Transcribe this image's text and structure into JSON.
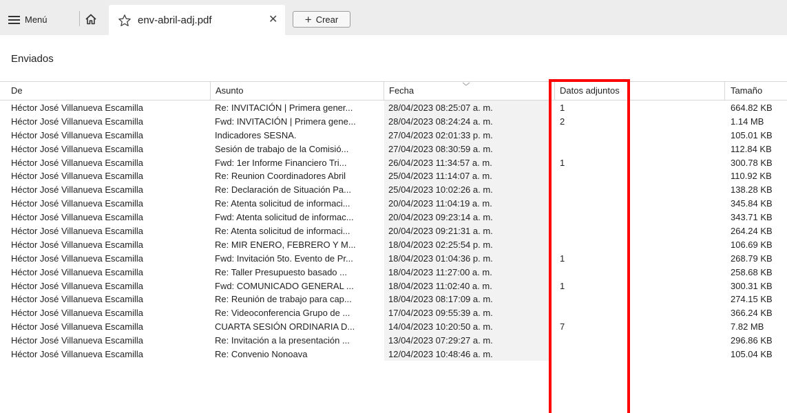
{
  "toolbar": {
    "menu_label": "Menú",
    "home_icon": "home-icon",
    "create_label": "Crear",
    "create_icon": "plus-icon"
  },
  "tab": {
    "title": "env-abril-adj.pdf",
    "star_icon": "star-outline-icon",
    "close_glyph": "✕"
  },
  "folder": {
    "title": "Enviados"
  },
  "table": {
    "columns": {
      "from": "De",
      "subject": "Asunto",
      "date": "Fecha",
      "attachments": "Datos adjuntos",
      "size": "Tamaño"
    },
    "sorted_column": "date",
    "rows": [
      {
        "from": "Héctor José Villanueva Escamilla",
        "subject": "Re: INVITACIÓN | Primera gener...",
        "date": "28/04/2023 08:25:07 a. m.",
        "attachments": "1",
        "size": "664.82 KB"
      },
      {
        "from": "Héctor José Villanueva Escamilla",
        "subject": "Fwd: INVITACIÓN | Primera gene...",
        "date": "28/04/2023 08:24:24 a. m.",
        "attachments": "2",
        "size": "1.14 MB"
      },
      {
        "from": "Héctor José Villanueva Escamilla",
        "subject": "Indicadores SESNA.",
        "date": "27/04/2023 02:01:33 p. m.",
        "attachments": "",
        "size": "105.01 KB"
      },
      {
        "from": "Héctor José Villanueva Escamilla",
        "subject": "Sesión de trabajo de la Comisió...",
        "date": "27/04/2023 08:30:59 a. m.",
        "attachments": "",
        "size": "112.84 KB"
      },
      {
        "from": "Héctor José Villanueva Escamilla",
        "subject": "Fwd: 1er Informe Financiero Tri...",
        "date": "26/04/2023 11:34:57 a. m.",
        "attachments": "1",
        "size": "300.78 KB"
      },
      {
        "from": "Héctor José Villanueva Escamilla",
        "subject": "Re: Reunion Coordinadores Abril",
        "date": "25/04/2023 11:14:07 a. m.",
        "attachments": "",
        "size": "110.92 KB"
      },
      {
        "from": "Héctor José Villanueva Escamilla",
        "subject": "Re: Declaración de Situación Pa...",
        "date": "25/04/2023 10:02:26 a. m.",
        "attachments": "",
        "size": "138.28 KB"
      },
      {
        "from": "Héctor José Villanueva Escamilla",
        "subject": "Re: Atenta solicitud de informaci...",
        "date": "20/04/2023 11:04:19 a. m.",
        "attachments": "",
        "size": "345.84 KB"
      },
      {
        "from": "Héctor José Villanueva Escamilla",
        "subject": "Fwd: Atenta solicitud de informac...",
        "date": "20/04/2023 09:23:14 a. m.",
        "attachments": "",
        "size": "343.71 KB"
      },
      {
        "from": "Héctor José Villanueva Escamilla",
        "subject": "Re: Atenta solicitud de informaci...",
        "date": "20/04/2023 09:21:31 a. m.",
        "attachments": "",
        "size": "264.24 KB"
      },
      {
        "from": "Héctor José Villanueva Escamilla",
        "subject": "Re: MIR ENERO, FEBRERO Y M...",
        "date": "18/04/2023 02:25:54 p. m.",
        "attachments": "",
        "size": "106.69 KB"
      },
      {
        "from": "Héctor José Villanueva Escamilla",
        "subject": "Fwd: Invitación 5to. Evento de Pr...",
        "date": "18/04/2023 01:04:36 p. m.",
        "attachments": "1",
        "size": "268.79 KB"
      },
      {
        "from": "Héctor José Villanueva Escamilla",
        "subject": "Re: Taller Presupuesto basado ...",
        "date": "18/04/2023 11:27:00 a. m.",
        "attachments": "",
        "size": "258.68 KB"
      },
      {
        "from": "Héctor José Villanueva Escamilla",
        "subject": "Fwd: COMUNICADO GENERAL ...",
        "date": "18/04/2023 11:02:40 a. m.",
        "attachments": "1",
        "size": "300.31 KB"
      },
      {
        "from": "Héctor José Villanueva Escamilla",
        "subject": "Re: Reunión de trabajo para cap...",
        "date": "18/04/2023 08:17:09 a. m.",
        "attachments": "",
        "size": "274.15 KB"
      },
      {
        "from": "Héctor José Villanueva Escamilla",
        "subject": "Re: Videoconferencia Grupo de ...",
        "date": "17/04/2023 09:55:39 a. m.",
        "attachments": "",
        "size": "366.24 KB"
      },
      {
        "from": "Héctor José Villanueva Escamilla",
        "subject": "CUARTA SESIÓN ORDINARIA D...",
        "date": "14/04/2023 10:20:50 a. m.",
        "attachments": "7",
        "size": "7.82 MB"
      },
      {
        "from": "Héctor José Villanueva Escamilla",
        "subject": "Re: Invitación a la presentación ...",
        "date": "13/04/2023 07:29:27 a. m.",
        "attachments": "",
        "size": "296.86 KB"
      },
      {
        "from": "Héctor José Villanueva Escamilla",
        "subject": "Re: Convenio Nonoava",
        "date": "12/04/2023 10:48:46 a. m.",
        "attachments": "",
        "size": "105.04 KB"
      }
    ]
  },
  "highlight": {
    "color": "#ff0000",
    "target_column": "attachments"
  }
}
